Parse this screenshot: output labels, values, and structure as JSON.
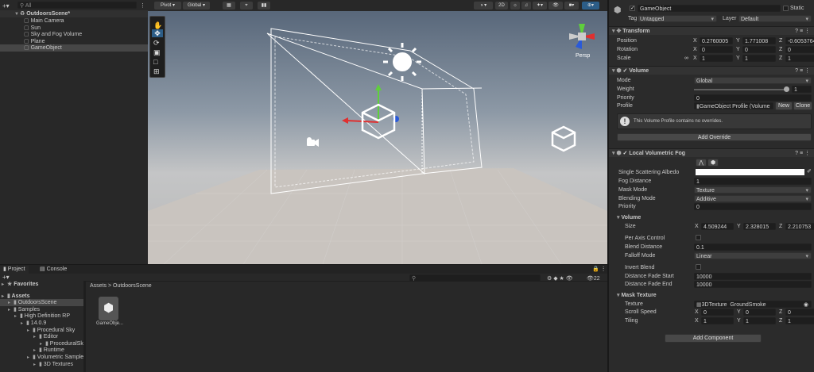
{
  "hierarchy": {
    "search_placeholder": "All",
    "scene": "OutdoorsScene*",
    "items": [
      "Main Camera",
      "Sun",
      "Sky and Fog Volume",
      "Plane",
      "GameObject"
    ]
  },
  "scene_toolbar": {
    "pivot": "Pivot",
    "global": "Global",
    "mode_2d": "2D",
    "persp": "Persp"
  },
  "inspector": {
    "name": "GameObject",
    "static": "Static",
    "tag_label": "Tag",
    "tag": "Untagged",
    "layer_label": "Layer",
    "layer": "Default",
    "transform": {
      "title": "Transform",
      "position_label": "Position",
      "rotation_label": "Rotation",
      "scale_label": "Scale",
      "position": [
        "0.2760005",
        "1.771008",
        "-0.6053764"
      ],
      "rotation": [
        "0",
        "0",
        "0"
      ],
      "scale": [
        "1",
        "1",
        "1"
      ]
    },
    "volume": {
      "title": "Volume",
      "mode_label": "Mode",
      "mode": "Global",
      "weight_label": "Weight",
      "weight": "1",
      "weight_fraction": 1,
      "priority_label": "Priority",
      "priority": "0",
      "profile_label": "Profile",
      "profile": "GameObject Profile (Volume",
      "new": "New",
      "clone": "Clone",
      "info": "This Volume Profile contains no overrides.",
      "add_override": "Add Override"
    },
    "fog": {
      "title": "Local Volumetric Fog",
      "albedo_label": "Single Scattering Albedo",
      "albedo_color": "#ffffff",
      "fog_distance_label": "Fog Distance",
      "fog_distance": "1",
      "mask_mode_label": "Mask Mode",
      "mask_mode": "Texture",
      "blending_label": "Blending Mode",
      "blending": "Additive",
      "priority_label": "Priority",
      "priority": "0",
      "volume_section": "Volume",
      "size_label": "Size",
      "size": [
        "4.509244",
        "2.328015",
        "2.210753"
      ],
      "per_axis_label": "Per Axis Control",
      "blend_distance_label": "Blend Distance",
      "blend_distance": "0.1",
      "falloff_label": "Falloff Mode",
      "falloff": "Linear",
      "invert_label": "Invert Blend",
      "fade_start_label": "Distance Fade Start",
      "fade_start": "10000",
      "fade_end_label": "Distance Fade End",
      "fade_end": "10000",
      "mask_section": "Mask Texture",
      "texture_label": "Texture",
      "texture": "3DTexture_GroundSmoke",
      "scroll_label": "Scroll Speed",
      "scroll": [
        "0",
        "0",
        "0"
      ],
      "tiling_label": "Tiling",
      "tiling": [
        "1",
        "1",
        "1"
      ]
    },
    "add_component": "Add Component"
  },
  "axes": {
    "x": "X",
    "y": "Y",
    "z": "Z"
  },
  "project": {
    "tab_project": "Project",
    "tab_console": "Console",
    "breadcrumb_root": "Assets",
    "breadcrumb_sep": ">",
    "breadcrumb_leaf": "OutdoorsScene",
    "count": "22",
    "asset_name": "GameObje...",
    "tree": [
      {
        "label": "Favorites",
        "indent": 0,
        "bold": true
      },
      {
        "label": "Assets",
        "indent": 0,
        "bold": true
      },
      {
        "label": "OutdoorsScene",
        "indent": 1
      },
      {
        "label": "Samples",
        "indent": 1
      },
      {
        "label": "High Definition RP",
        "indent": 2
      },
      {
        "label": "14.0.9",
        "indent": 3
      },
      {
        "label": "Procedural Sky",
        "indent": 4
      },
      {
        "label": "Editor",
        "indent": 5
      },
      {
        "label": "ProceduralSk",
        "indent": 6
      },
      {
        "label": "Runtime",
        "indent": 5
      },
      {
        "label": "Volumetric Sample",
        "indent": 4
      },
      {
        "label": "3D Textures",
        "indent": 5
      }
    ]
  }
}
